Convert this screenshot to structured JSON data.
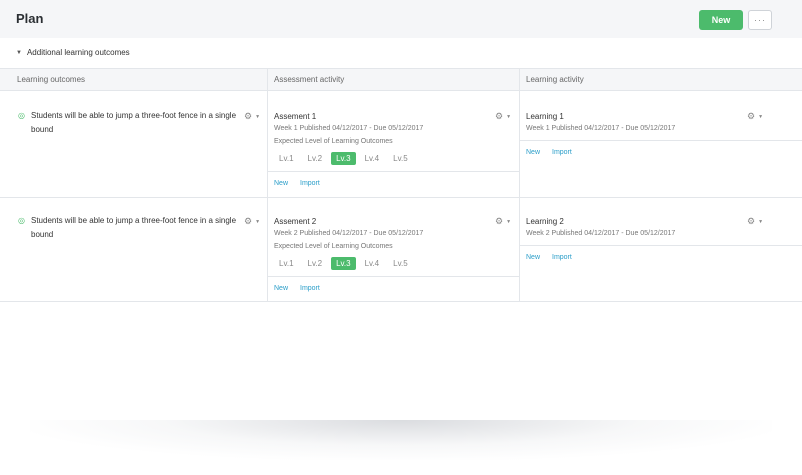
{
  "header": {
    "title": "Plan",
    "new_label": "New",
    "more_label": "···"
  },
  "section": {
    "toggle_label": "Additional learning outcomes"
  },
  "columns": [
    "Learning outcomes",
    "Assessment activity",
    "Learning activity"
  ],
  "rows": [
    {
      "outcome": "Students will be able to jump a three-foot fence in a single bound",
      "assessment": {
        "title": "Assement 1",
        "meta": "Week 1 Published 04/12/2017 - Due 05/12/2017",
        "expected_label": "Expected Level of Learning Outcomes",
        "levels": [
          "Lv.1",
          "Lv.2",
          "Lv.3",
          "Lv.4",
          "Lv.5"
        ],
        "active_level": "Lv.3",
        "new_link": "New",
        "import_link": "Import"
      },
      "learning": {
        "title": "Learning 1",
        "meta": "Week 1 Published 04/12/2017 - Due 05/12/2017",
        "new_link": "New",
        "import_link": "Import"
      }
    },
    {
      "outcome": "Students will be able to jump a three-foot fence in a single bound",
      "assessment": {
        "title": "Assement 2",
        "meta": "Week 2 Published 04/12/2017 - Due 05/12/2017",
        "expected_label": "Expected Level of Learning Outcomes",
        "levels": [
          "Lv.1",
          "Lv.2",
          "Lv.3",
          "Lv.4",
          "Lv.5"
        ],
        "active_level": "Lv.3",
        "new_link": "New",
        "import_link": "Import"
      },
      "learning": {
        "title": "Learning 2",
        "meta": "Week 2 Published 04/12/2017 - Due 05/12/2017",
        "new_link": "New",
        "import_link": "Import"
      }
    }
  ],
  "colors": {
    "accent": "#4cbb6c",
    "link": "#2b9ec9",
    "header_bg": "#f5f6f8",
    "border": "#e3e6ea"
  },
  "icons": {
    "gear": "gear-icon",
    "leaf": "target-icon",
    "caret": "caret-down-icon"
  }
}
